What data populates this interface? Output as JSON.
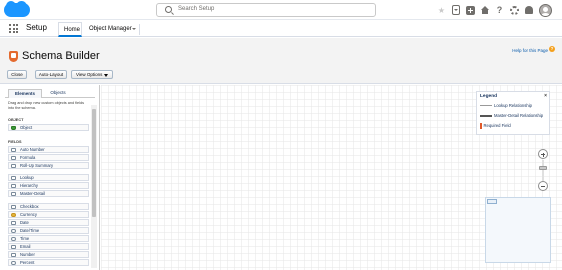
{
  "header": {
    "search_placeholder": "Search Setup",
    "icons": [
      "salesforce-cloud-icon",
      "star-icon",
      "favorites-dropdown-icon",
      "add-icon",
      "home-icon",
      "help-icon",
      "gear-icon",
      "bell-icon",
      "avatar"
    ]
  },
  "nav": {
    "app_name": "Setup",
    "tabs": [
      {
        "label": "Home",
        "active": true
      },
      {
        "label": "Object Manager",
        "active": false
      }
    ]
  },
  "page": {
    "title": "Schema Builder",
    "help_link": "Help for this Page",
    "buttons": {
      "close": "Close",
      "auto_layout": "Auto-Layout",
      "view_options": "View Options"
    }
  },
  "panel": {
    "tabs": {
      "elements": "Elements",
      "objects": "Objects"
    },
    "hint": "Drag and drop new custom objects and fields into the schema.",
    "sections": {
      "object": "OBJECT",
      "fields": "FIELDS"
    },
    "object_items": [
      "Object"
    ],
    "field_groups": [
      [
        "Auto Number",
        "Formula",
        "Roll-Up Summary"
      ],
      [
        "Lookup",
        "Hierarchy",
        "Master-Detail"
      ],
      [
        "Checkbox",
        "Currency",
        "Date",
        "Date/Time",
        "Time",
        "Email",
        "Number",
        "Percent"
      ]
    ]
  },
  "legend": {
    "title": "Legend",
    "close": "×",
    "rows": [
      "Lookup Relationship",
      "Master-Detail Relationship",
      "Required Field"
    ]
  },
  "colors": {
    "brand": "#1b96ff",
    "active_tab_underline": "#0176d3",
    "schema_icon": "#e46a2e",
    "required_field": "#e05a2b"
  }
}
